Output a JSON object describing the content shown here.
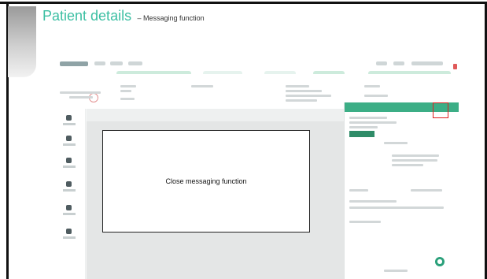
{
  "slide": {
    "title": "Patient details",
    "subtitle": "– Messaging function"
  },
  "callout": {
    "text": "Close messaging function"
  },
  "app": {
    "message_button_icon": "chat-icon",
    "highlight_color": "#e02020",
    "accent_color": "#3cbfa3"
  }
}
